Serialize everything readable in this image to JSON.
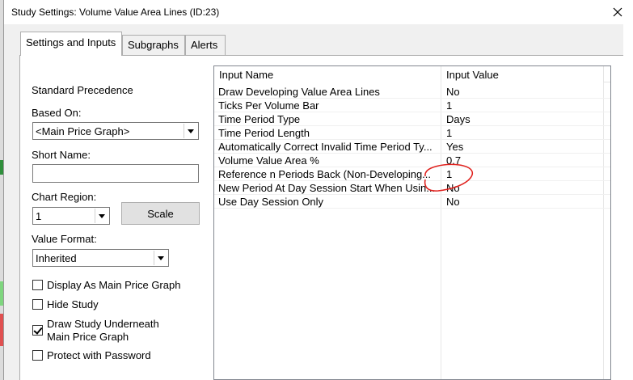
{
  "window": {
    "title": "Study Settings: Volume Value Area Lines (ID:23)"
  },
  "tabs": [
    {
      "label": "Settings and Inputs",
      "active": true
    },
    {
      "label": "Subgraphs",
      "active": false
    },
    {
      "label": "Alerts",
      "active": false
    }
  ],
  "left": {
    "precedence": "Standard Precedence",
    "based_on_label": "Based On:",
    "based_on_value": "<Main Price Graph>",
    "short_name_label": "Short Name:",
    "short_name_value": "",
    "chart_region_label": "Chart Region:",
    "chart_region_value": "1",
    "scale_button": "Scale",
    "value_format_label": "Value Format:",
    "value_format_value": "Inherited",
    "checkboxes": [
      {
        "label": "Display As Main Price Graph",
        "checked": false
      },
      {
        "label": "Hide Study",
        "checked": false
      },
      {
        "label": "Draw Study Underneath",
        "label2": "Main Price Graph",
        "checked": true
      },
      {
        "label": "Protect with Password",
        "checked": false
      }
    ]
  },
  "grid": {
    "headers": [
      "Input Name",
      "Input Value"
    ],
    "rows": [
      {
        "name": "Draw Developing Value Area Lines",
        "value": "No"
      },
      {
        "name": "Ticks Per Volume Bar",
        "value": "1"
      },
      {
        "name": "Time Period Type",
        "value": "Days"
      },
      {
        "name": "Time Period Length",
        "value": "1"
      },
      {
        "name": "Automatically Correct Invalid Time Period Ty...",
        "value": "Yes"
      },
      {
        "name": "Volume Value Area %",
        "value": "0.7"
      },
      {
        "name": "Reference n Periods Back (Non-Developing...",
        "value": "1"
      },
      {
        "name": "New Period At Day Session Start When Usin...",
        "value": "No"
      },
      {
        "name": "Use Day Session Only",
        "value": "No"
      }
    ]
  },
  "colors": {
    "annotation": "#e0201c"
  }
}
